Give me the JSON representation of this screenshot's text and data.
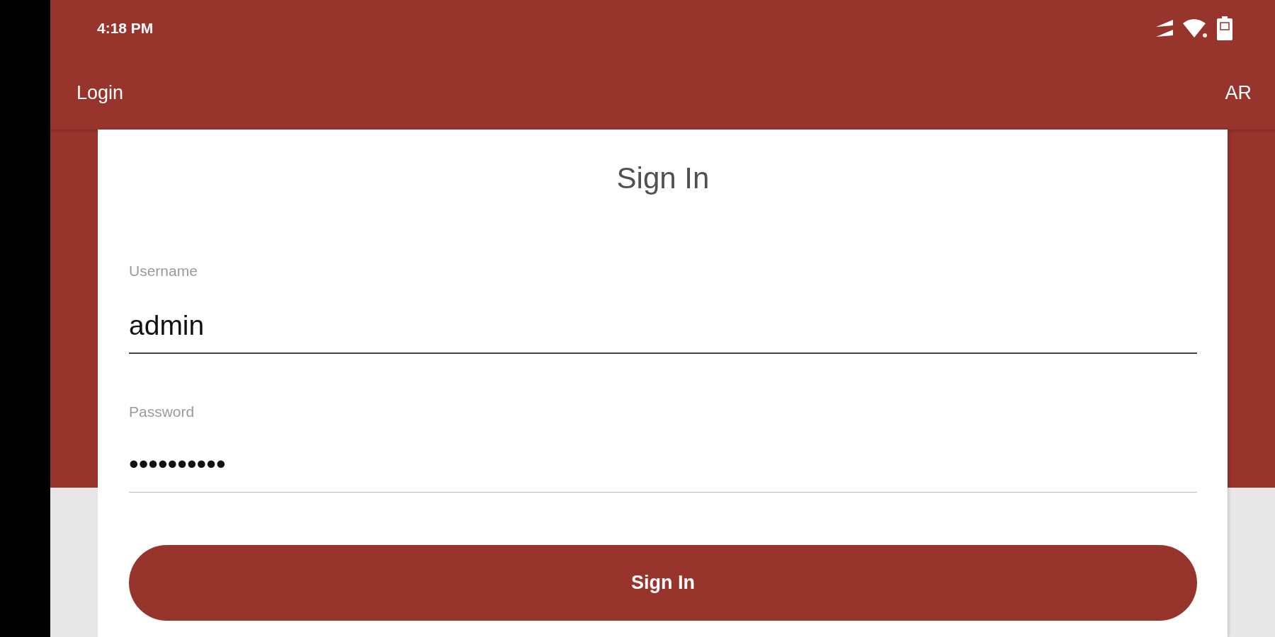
{
  "status_bar": {
    "time": "4:18 PM"
  },
  "app_bar": {
    "title": "Login",
    "language_button": "AR"
  },
  "card": {
    "title": "Sign In",
    "fields": [
      {
        "label": "Username",
        "value": "admin",
        "focused": true
      },
      {
        "label": "Password",
        "value": "••••••••••",
        "focused": false
      }
    ],
    "submit_button": "Sign In"
  }
}
